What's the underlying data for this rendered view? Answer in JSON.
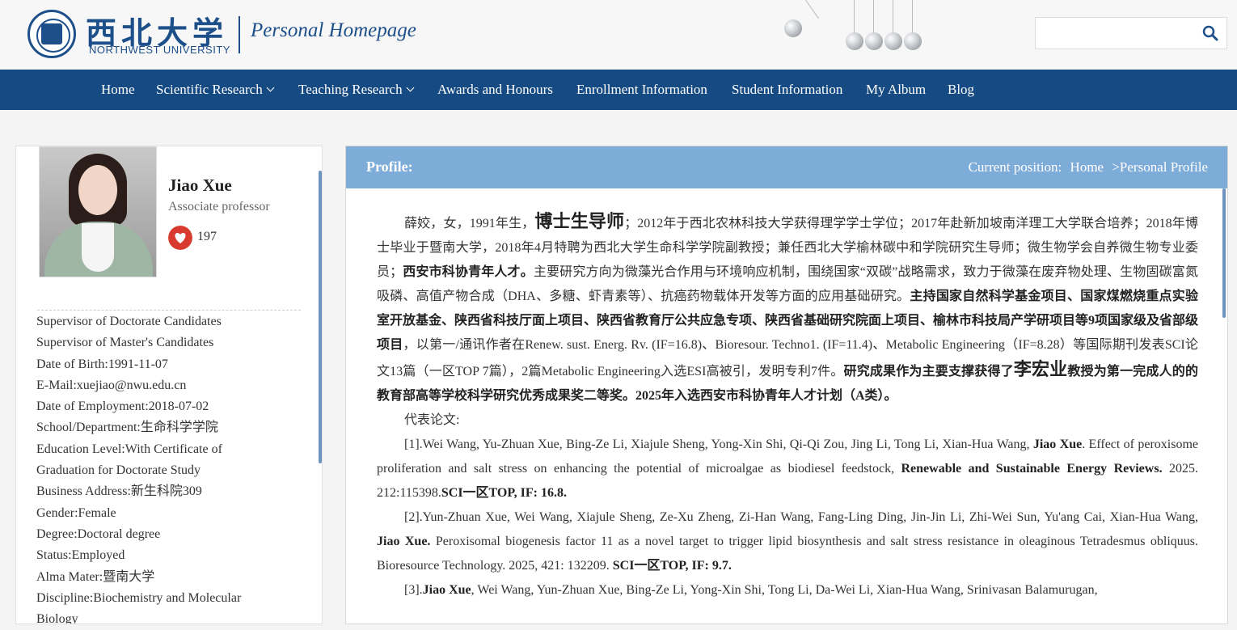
{
  "header": {
    "logo_cn": "西北大学",
    "logo_en": "NORTHWEST UNIVERSITY",
    "site_name": "Personal Homepage",
    "search_placeholder": ""
  },
  "nav": [
    {
      "label": "Home",
      "dropdown": false
    },
    {
      "label": "Scientific Research",
      "dropdown": true
    },
    {
      "label": "Teaching Research",
      "dropdown": true
    },
    {
      "label": "Awards and Honours",
      "dropdown": false
    },
    {
      "label": "Enrollment Information",
      "dropdown": false
    },
    {
      "label": "Student Information",
      "dropdown": false
    },
    {
      "label": "My Album",
      "dropdown": false
    },
    {
      "label": "Blog",
      "dropdown": false
    }
  ],
  "profile": {
    "name": "Jiao Xue",
    "title": "Associate professor",
    "likes": "197",
    "info": [
      "Supervisor of Doctorate Candidates",
      "Supervisor of Master's Candidates",
      "Date of Birth:1991-11-07",
      "E-Mail:xuejiao@nwu.edu.cn",
      "Date of Employment:2018-07-02",
      "School/Department:生命科学学院",
      "Education Level:With Certificate of",
      "Graduation for Doctorate Study",
      "Business Address:新生科院309",
      "Gender:Female",
      "Degree:Doctoral degree",
      "Status:Employed",
      "Alma Mater:暨南大学",
      "Discipline:Biochemistry and Molecular",
      "Biology"
    ]
  },
  "panel": {
    "title": "Profile:",
    "crumb_label": "Current position:",
    "crumb_home": "Home",
    "crumb_current": ">Personal Profile"
  },
  "bio": {
    "p1": [
      {
        "t": "薛姣，女，1991年生，",
        "s": "n"
      },
      {
        "t": "博士生导师",
        "s": "big"
      },
      {
        "t": "；2012年于西北农林科技大学获得理学学士学位；2017年赴新加坡南洋理工大学联合培养；2018年博士毕业于暨南大学，2018年4月特聘为西北大学生命科学学院副教授；兼任西北大学榆林碳中和学院研究生导师；微生物学会自养微生物专业委员；",
        "s": "n"
      },
      {
        "t": "西安市科协青年人才。",
        "s": "b"
      },
      {
        "t": "主要研究方向为微藻光合作用与环境响应机制，围绕国家“双碳”战略需求，致力于微藻在废弃物处理、生物固碳富氮吸磷、高值产物合成（DHA、多糖、虾青素等）、抗癌药物载体开发等方面的应用基础研究。",
        "s": "n"
      },
      {
        "t": "主持国家自然科学基金项目、国家煤燃烧重点实验室开放基金、陕西省科技厅面上项目、陕西省教育厅公共应急专项、陕西省基础研究院面上项目、榆林市科技局产学研项目等9项国家级及省部级项目",
        "s": "b"
      },
      {
        "t": "，以第一/通讯作者在Renew. sust. Energ. Rv. (IF=16.8)、Bioresour. Techno1. (IF=11.4)、Metabolic Engineering（IF=8.28）等国际期刊发表SCI论文13篇（一区TOP 7篇），2篇Metabolic Engineering入选ESI高被引，发明专利7件。",
        "s": "n"
      },
      {
        "t": "研究成果作为主要支撑获得了",
        "s": "b"
      },
      {
        "t": "李宏业",
        "s": "big"
      },
      {
        "t": "教授为第一完成人的的教育部高等学校科学研究优秀成果奖二等奖。2025年入选西安市科协青年人才计划（A类）。",
        "s": "b"
      }
    ],
    "p2": [
      {
        "t": "代表论文:",
        "s": "n"
      }
    ],
    "p3": [
      {
        "t": "[1].Wei Wang, Yu-Zhuan Xue, Bing-Ze Li, Xiajule Sheng, Yong-Xin Shi, Qi-Qi Zou, Jing Li, Tong Li, Xian-Hua Wang, ",
        "s": "n"
      },
      {
        "t": "Jiao Xue",
        "s": "b"
      },
      {
        "t": ". Effect of peroxisome proliferation and salt stress on enhancing the potential of microalgae as biodiesel feedstock, ",
        "s": "n"
      },
      {
        "t": "Renewable and Sustainable Energy Reviews.",
        "s": "b"
      },
      {
        "t": " 2025. 212:115398.",
        "s": "n"
      },
      {
        "t": "SCI一区TOP, IF: 16.8.",
        "s": "b"
      }
    ],
    "p4": [
      {
        "t": "[2].Yun-Zhuan Xue, Wei Wang, Xiajule Sheng, Ze-Xu Zheng, Zi-Han Wang, Fang-Ling Ding, Jin-Jin Li, Zhi-Wei Sun, Yu'ang Cai, Xian-Hua Wang, ",
        "s": "n"
      },
      {
        "t": "Jiao Xue.",
        "s": "b"
      },
      {
        "t": " Peroxisomal biogenesis factor 11 as a novel target to trigger lipid biosynthesis and salt stress resistance in oleaginous Tetradesmus obliquus. Bioresource Technology. 2025, 421: 132209. ",
        "s": "n"
      },
      {
        "t": "SCI一区TOP, IF: 9.7.",
        "s": "b"
      }
    ],
    "p5": [
      {
        "t": "[3].",
        "s": "n"
      },
      {
        "t": "Jiao Xue",
        "s": "b"
      },
      {
        "t": ", Wei Wang, Yun-Zhuan Xue, Bing-Ze Li, Yong-Xin Shi, Tong Li, Da-Wei Li, Xian-Hua Wang, Srinivasan Balamurugan,",
        "s": "n"
      }
    ]
  },
  "colors": {
    "nav_bg": "#164a82",
    "panel_head_bg": "#7eacd9",
    "brand": "#1d4f8a"
  }
}
